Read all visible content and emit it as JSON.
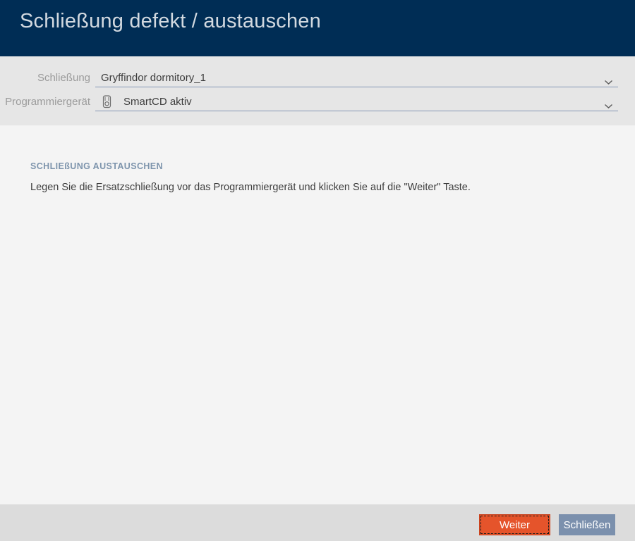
{
  "window": {
    "title": "Schließung defekt / austauschen"
  },
  "form": {
    "fields": [
      {
        "label": "Schließung",
        "value": "Gryffindor dormitory_1",
        "icon": null
      },
      {
        "label": "Programmiergerät",
        "value": "SmartCD aktiv",
        "icon": "smartcd-device-icon"
      }
    ]
  },
  "main": {
    "section_title": "SCHLIEßUNG AUSTAUSCHEN",
    "instruction": "Legen Sie die Ersatzschließung vor das Programmiergerät und klicken Sie auf die \"Weiter\" Taste."
  },
  "footer": {
    "next_label": "Weiter",
    "close_label": "Schließen"
  },
  "icons": [
    "smartcd-device-icon",
    "chevron-down-icon"
  ],
  "colors": {
    "header_bg": "#002d55",
    "header_title": "#d2d9e0",
    "form_bg": "#e6e6e6",
    "main_bg": "#f4f4f4",
    "footer_bg": "#dcdcdc",
    "field_underline": "#8597b5",
    "label_text": "#9b9b9b",
    "value_text": "#3c3c3c",
    "section_title": "#7d94ac",
    "accent_orange": "#e5542b",
    "close_button_blue": "#7b90ad"
  }
}
